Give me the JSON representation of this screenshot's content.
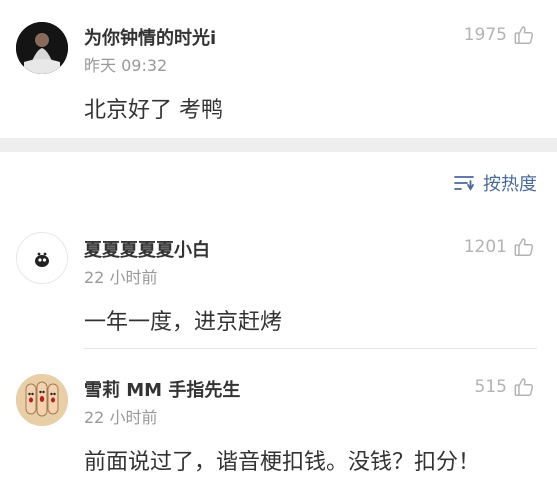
{
  "comments_top": {
    "username": "为你钟情的时光i",
    "time": "昨天 09:32",
    "likes": "1975",
    "text": "北京好了 考鸭"
  },
  "sort": {
    "label": "按热度",
    "icon": "sort-lines-icon"
  },
  "comments": [
    {
      "username": "夏夏夏夏夏小白",
      "time": "22 小时前",
      "likes": "1201",
      "text": "一年一度，进京赶烤"
    },
    {
      "username": "雪莉 MM 手指先生",
      "time": "22 小时前",
      "likes": "515",
      "text": "前面说过了，谐音梗扣钱。没钱？扣分！"
    }
  ],
  "colors": {
    "accent": "#4a6a9a",
    "muted": "#999999",
    "separator": "#eeeeee"
  }
}
